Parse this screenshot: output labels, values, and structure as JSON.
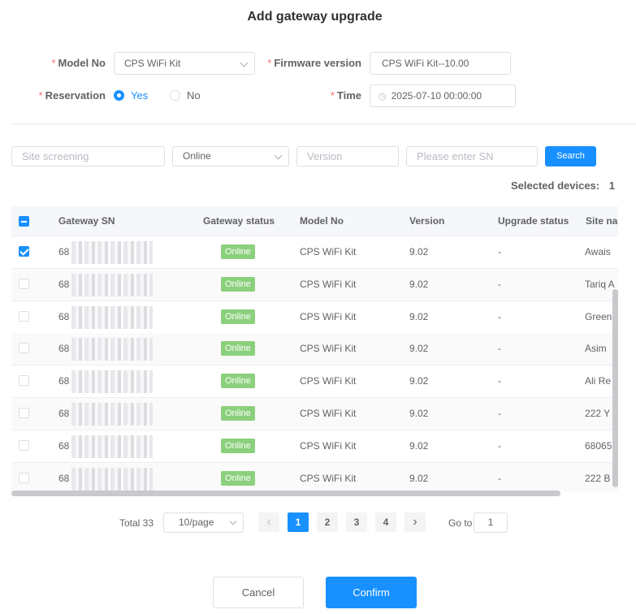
{
  "dialog": {
    "title": "Add gateway upgrade"
  },
  "form": {
    "model_no": {
      "label": "Model No",
      "value": "CPS WiFi Kit"
    },
    "firmware": {
      "label": "Firmware version",
      "value": "CPS WiFi Kit--10.00"
    },
    "reservation": {
      "label": "Reservation",
      "options": [
        "Yes",
        "No"
      ],
      "selected": "Yes"
    },
    "time": {
      "label": "Time",
      "value": "2025-07-10 00:00:00"
    }
  },
  "filters": {
    "site_placeholder": "Site screening",
    "status_value": "Online",
    "version_placeholder": "Version",
    "sn_placeholder": "Please enter SN",
    "search_label": "Search"
  },
  "selected": {
    "label": "Selected devices:",
    "count": "1"
  },
  "table": {
    "columns": [
      "Gateway SN",
      "Gateway status",
      "Model No",
      "Version",
      "Upgrade status",
      "Site nar"
    ],
    "rows": [
      {
        "sn": "68",
        "status": "Online",
        "model": "CPS WiFi Kit",
        "version": "9.02",
        "upgrade": "-",
        "site": "Awais",
        "checked": true
      },
      {
        "sn": "68",
        "status": "Online",
        "model": "CPS WiFi Kit",
        "version": "9.02",
        "upgrade": "-",
        "site": "Tariq A",
        "checked": false
      },
      {
        "sn": "68",
        "status": "Online",
        "model": "CPS WiFi Kit",
        "version": "9.02",
        "upgrade": "-",
        "site": "Green",
        "checked": false
      },
      {
        "sn": "68",
        "status": "Online",
        "model": "CPS WiFi Kit",
        "version": "9.02",
        "upgrade": "-",
        "site": "Asim",
        "checked": false
      },
      {
        "sn": "68",
        "status": "Online",
        "model": "CPS WiFi Kit",
        "version": "9.02",
        "upgrade": "-",
        "site": "Ali Re",
        "checked": false
      },
      {
        "sn": "68",
        "status": "Online",
        "model": "CPS WiFi Kit",
        "version": "9.02",
        "upgrade": "-",
        "site": "222 Y",
        "checked": false
      },
      {
        "sn": "68",
        "status": "Online",
        "model": "CPS WiFi Kit",
        "version": "9.02",
        "upgrade": "-",
        "site": "68065",
        "checked": false
      },
      {
        "sn": "68",
        "status": "Online",
        "model": "CPS WiFi Kit",
        "version": "9.02",
        "upgrade": "-",
        "site": "222 B",
        "checked": false
      }
    ]
  },
  "pagination": {
    "total_label": "Total 33",
    "page_size": "10/page",
    "pages": [
      "1",
      "2",
      "3",
      "4"
    ],
    "current": "1",
    "goto_label": "Go to",
    "goto_value": "1",
    "prev_icon": "‹",
    "next_icon": "›"
  },
  "footer": {
    "cancel_label": "Cancel",
    "confirm_label": "Confirm"
  },
  "colors": {
    "accent": "#1890ff",
    "online_tag": "#8bd07c"
  }
}
